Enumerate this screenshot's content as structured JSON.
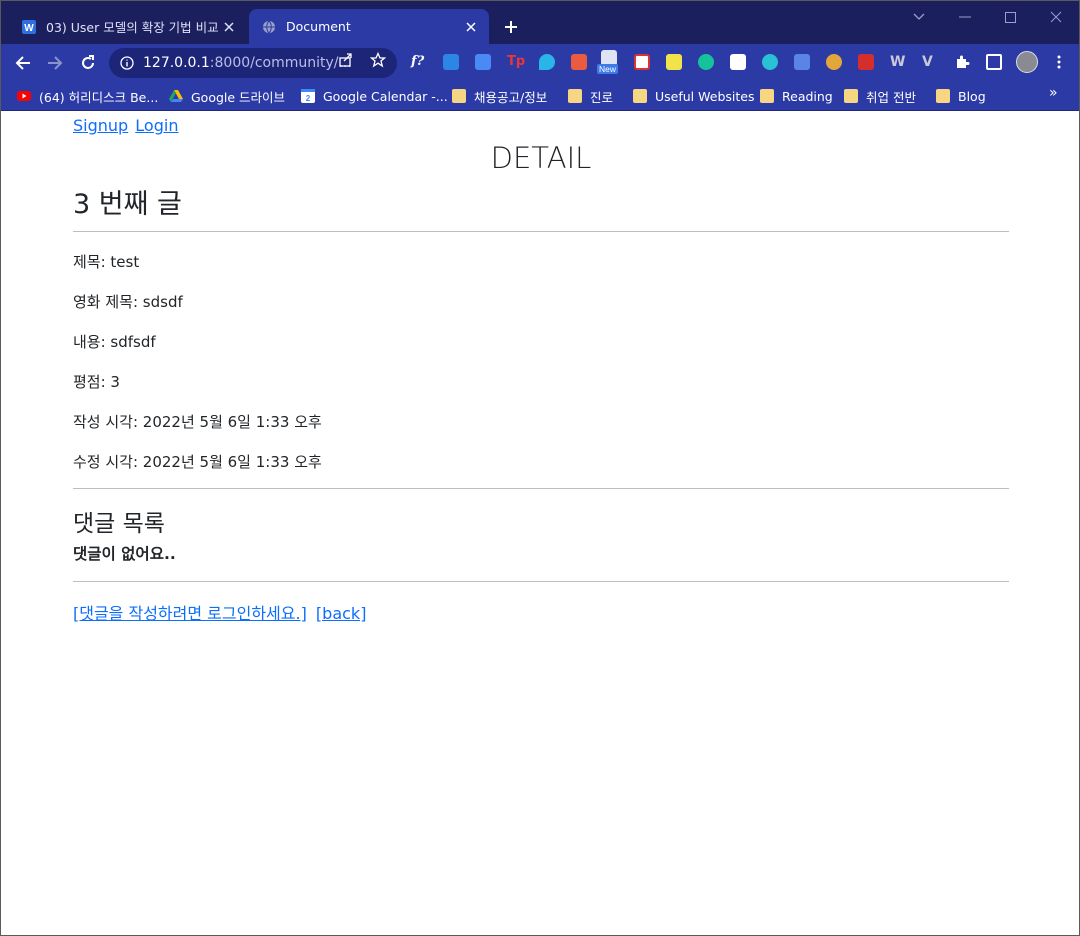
{
  "browser": {
    "tabs": [
      {
        "title": "03) User 모델의 확장 기법 비교",
        "favicon": "w-icon"
      },
      {
        "title": "Document",
        "favicon": "globe-icon"
      }
    ],
    "url_host": "127.0.0.1",
    "url_path": ":8000/community/...",
    "bookmarks": [
      {
        "label": "(64) 허리디스크 Be...",
        "icon": "youtube-icon"
      },
      {
        "label": "Google 드라이브",
        "icon": "drive-icon"
      },
      {
        "label": "Google Calendar -...",
        "icon": "calendar-icon"
      },
      {
        "label": "채용공고/정보",
        "icon": "folder-icon"
      },
      {
        "label": "진로",
        "icon": "folder-icon"
      },
      {
        "label": "Useful Websites",
        "icon": "folder-icon"
      },
      {
        "label": "Reading",
        "icon": "folder-icon"
      },
      {
        "label": "취업 전반",
        "icon": "folder-icon"
      },
      {
        "label": "Blog",
        "icon": "folder-icon"
      }
    ],
    "more_bookmarks": "»",
    "extension_badge": "New"
  },
  "page": {
    "signup_label": "Signup",
    "login_label": "Login",
    "heading": "DETAIL",
    "post_title": "3 번째 글",
    "fields": {
      "title": "제목: test",
      "movie_title": "영화 제목: sdsdf",
      "content": "내용: sdfsdf",
      "rank": "평점: 3",
      "created_at": "작성 시각: 2022년 5월 6일 1:33 오후",
      "updated_at": "수정 시각: 2022년 5월 6일 1:33 오후"
    },
    "comments_heading": "댓글 목록",
    "no_comments": "댓글이 없어요..",
    "login_to_comment": "[댓글을 작성하려면 로그인하세요.]",
    "back_label": "[back]"
  },
  "colors": {
    "tabstrip": "#1b1f5e",
    "toolbar": "#2c3aa6",
    "link": "#0d6efd",
    "text": "#212529"
  }
}
